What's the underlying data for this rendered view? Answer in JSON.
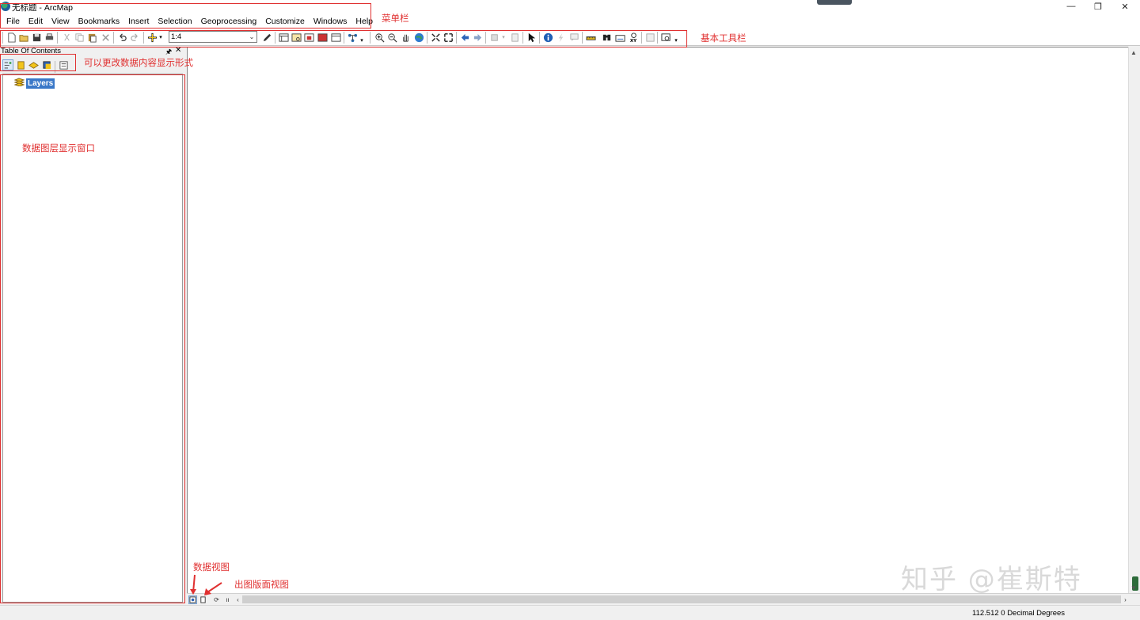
{
  "window": {
    "title": "无标题 - ArcMap",
    "minimize_glyph": "—",
    "restore_glyph": "❐",
    "close_glyph": "✕"
  },
  "menubar": {
    "items": [
      "File",
      "Edit",
      "View",
      "Bookmarks",
      "Insert",
      "Selection",
      "Geoprocessing",
      "Customize",
      "Windows",
      "Help"
    ]
  },
  "toolbar": {
    "scale_value": "1:4",
    "icons": [
      "new-document-icon",
      "open-folder-icon",
      "save-icon",
      "print-icon",
      "cut-icon",
      "copy-icon",
      "paste-icon",
      "delete-icon",
      "undo-icon",
      "redo-icon",
      "add-data-icon",
      "editor-icon",
      "catalog-icon",
      "search-window-icon",
      "arctoolbox-icon",
      "python-icon",
      "model-builder-icon",
      "zoom-in-icon",
      "zoom-out-icon",
      "pan-icon",
      "full-extent-icon",
      "fixed-zoom-in-icon",
      "fixed-zoom-out-icon",
      "back-extent-icon",
      "forward-extent-icon",
      "select-features-icon",
      "select-elements-icon",
      "identify-icon",
      "hyperlink-icon",
      "html-popup-icon",
      "measure-icon",
      "find-icon",
      "find-route-icon",
      "go-to-xy-icon",
      "time-slider-icon",
      "create-viewer-icon"
    ]
  },
  "toc": {
    "title": "Table Of Contents",
    "pin_glyph": "🖈",
    "close_glyph": "✕",
    "tool_icons": [
      "list-by-drawing-order-icon",
      "list-by-source-icon",
      "list-by-visibility-icon",
      "list-by-selection-icon",
      "options-icon"
    ],
    "layers_label": "Layers"
  },
  "status": {
    "coordinates": "112.512  0 Decimal Degrees"
  },
  "annotations": {
    "menubar_label": "菜单栏",
    "toolbar_label": "基本工具栏",
    "toc_tools_label": "可以更改数据内容显示形式",
    "toc_panel_label": "数据图层显示窗口",
    "data_view_label": "数据视图",
    "layout_view_label": "出图版面视图",
    "color": "#e03030"
  },
  "watermark": "知乎 @崔斯特"
}
